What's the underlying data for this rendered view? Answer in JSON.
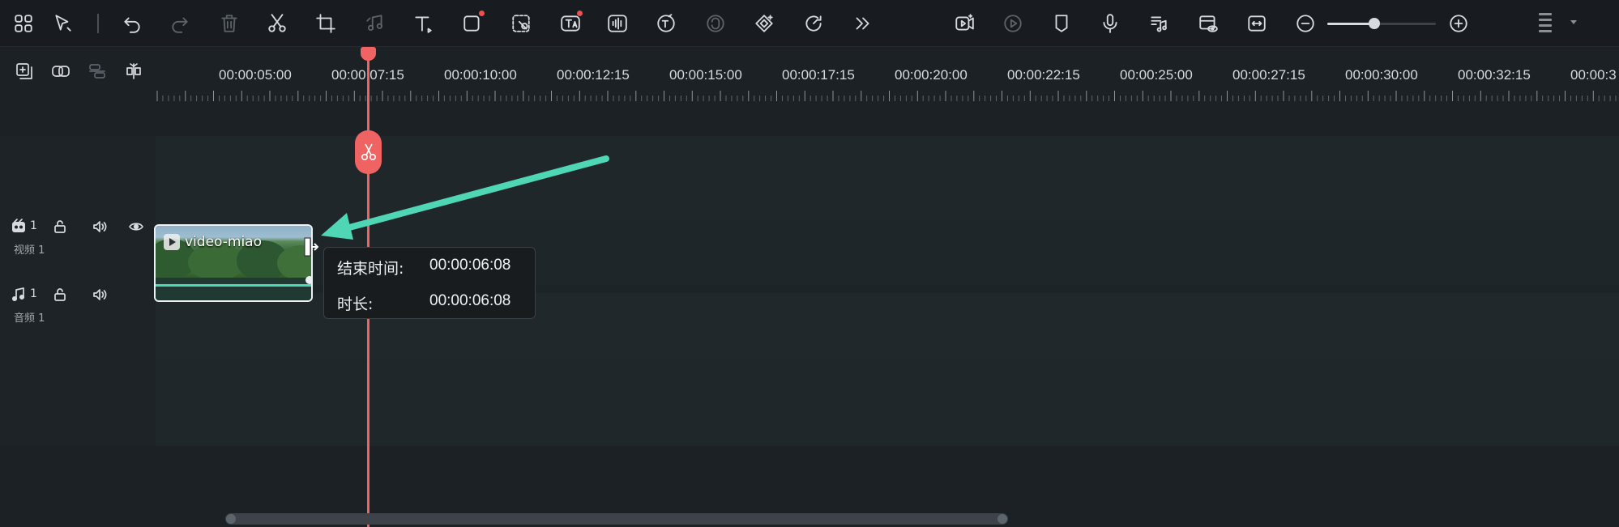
{
  "toolbar": {
    "left_tools": [
      {
        "icon": "layout-grid-icon",
        "name": "layout"
      },
      {
        "icon": "select-cursor-icon",
        "name": "select-tool"
      },
      {
        "icon": "undo-icon",
        "name": "undo"
      },
      {
        "icon": "redo-icon",
        "name": "redo",
        "disabled": true
      },
      {
        "icon": "delete-icon",
        "name": "delete",
        "disabled": true
      },
      {
        "icon": "scissors-icon",
        "name": "split"
      },
      {
        "icon": "crop-icon",
        "name": "crop"
      },
      {
        "icon": "audio-edit-icon",
        "name": "audio-edit",
        "disabled": true
      },
      {
        "icon": "text-icon",
        "name": "text"
      },
      {
        "icon": "shape-icon",
        "name": "shape",
        "badge": true
      },
      {
        "icon": "ai-cutout-icon",
        "name": "ai-cutout"
      },
      {
        "icon": "ai-text-icon",
        "name": "ai-text",
        "badge": true
      },
      {
        "icon": "audio-waveform-icon",
        "name": "audio-denoise"
      },
      {
        "icon": "speech-to-text-icon",
        "name": "speech-to-text"
      },
      {
        "icon": "text-to-speech-icon",
        "name": "text-to-speech",
        "disabled": true
      },
      {
        "icon": "keyframe-icon",
        "name": "keyframe"
      },
      {
        "icon": "speed-icon",
        "name": "speed"
      },
      {
        "icon": "more-chevrons-icon",
        "name": "more-tools"
      }
    ],
    "right_tools": [
      {
        "icon": "ai-video-icon",
        "name": "ai-video"
      },
      {
        "icon": "render-preview-icon",
        "name": "render-preview",
        "disabled": true
      },
      {
        "icon": "marker-icon",
        "name": "marker"
      },
      {
        "icon": "microphone-icon",
        "name": "record-voice"
      },
      {
        "icon": "music-list-icon",
        "name": "audio-mixer"
      },
      {
        "icon": "preview-quality-icon",
        "name": "preview-quality"
      },
      {
        "icon": "fit-timeline-icon",
        "name": "fit-timeline"
      },
      {
        "icon": "zoom-out-icon",
        "name": "zoom-out"
      },
      {
        "icon": "zoom-in-icon",
        "name": "zoom-in"
      }
    ],
    "zoom_level": 0.43
  },
  "track_tools": [
    {
      "icon": "add-track-icon",
      "name": "add-track"
    },
    {
      "icon": "link-icon",
      "name": "link-clips"
    },
    {
      "icon": "track-layout-icon",
      "name": "track-layout",
      "disabled": true
    },
    {
      "icon": "snap-icon",
      "name": "snap"
    }
  ],
  "ruler": {
    "labels": [
      "00:00:05:00",
      "00:00:07:15",
      "00:00:10:00",
      "00:00:12:15",
      "00:00:15:00",
      "00:00:17:15",
      "00:00:20:00",
      "00:00:22:15",
      "00:00:25:00",
      "00:00:27:15",
      "00:00:30:00",
      "00:00:32:15",
      "00:00:3"
    ]
  },
  "tracks": {
    "video": {
      "number": "1",
      "label": "视频 1"
    },
    "audio": {
      "number": "1",
      "label": "音频 1"
    }
  },
  "clip": {
    "title": "video-miao"
  },
  "tooltip": {
    "end_time_label": "结束时间:",
    "end_time_value": "00:00:06:08",
    "duration_label": "时长:",
    "duration_value": "00:00:06:08"
  },
  "colors": {
    "playhead": "#f06363",
    "arrow": "#4fd6b4",
    "clip_border": "#eef1f3"
  }
}
